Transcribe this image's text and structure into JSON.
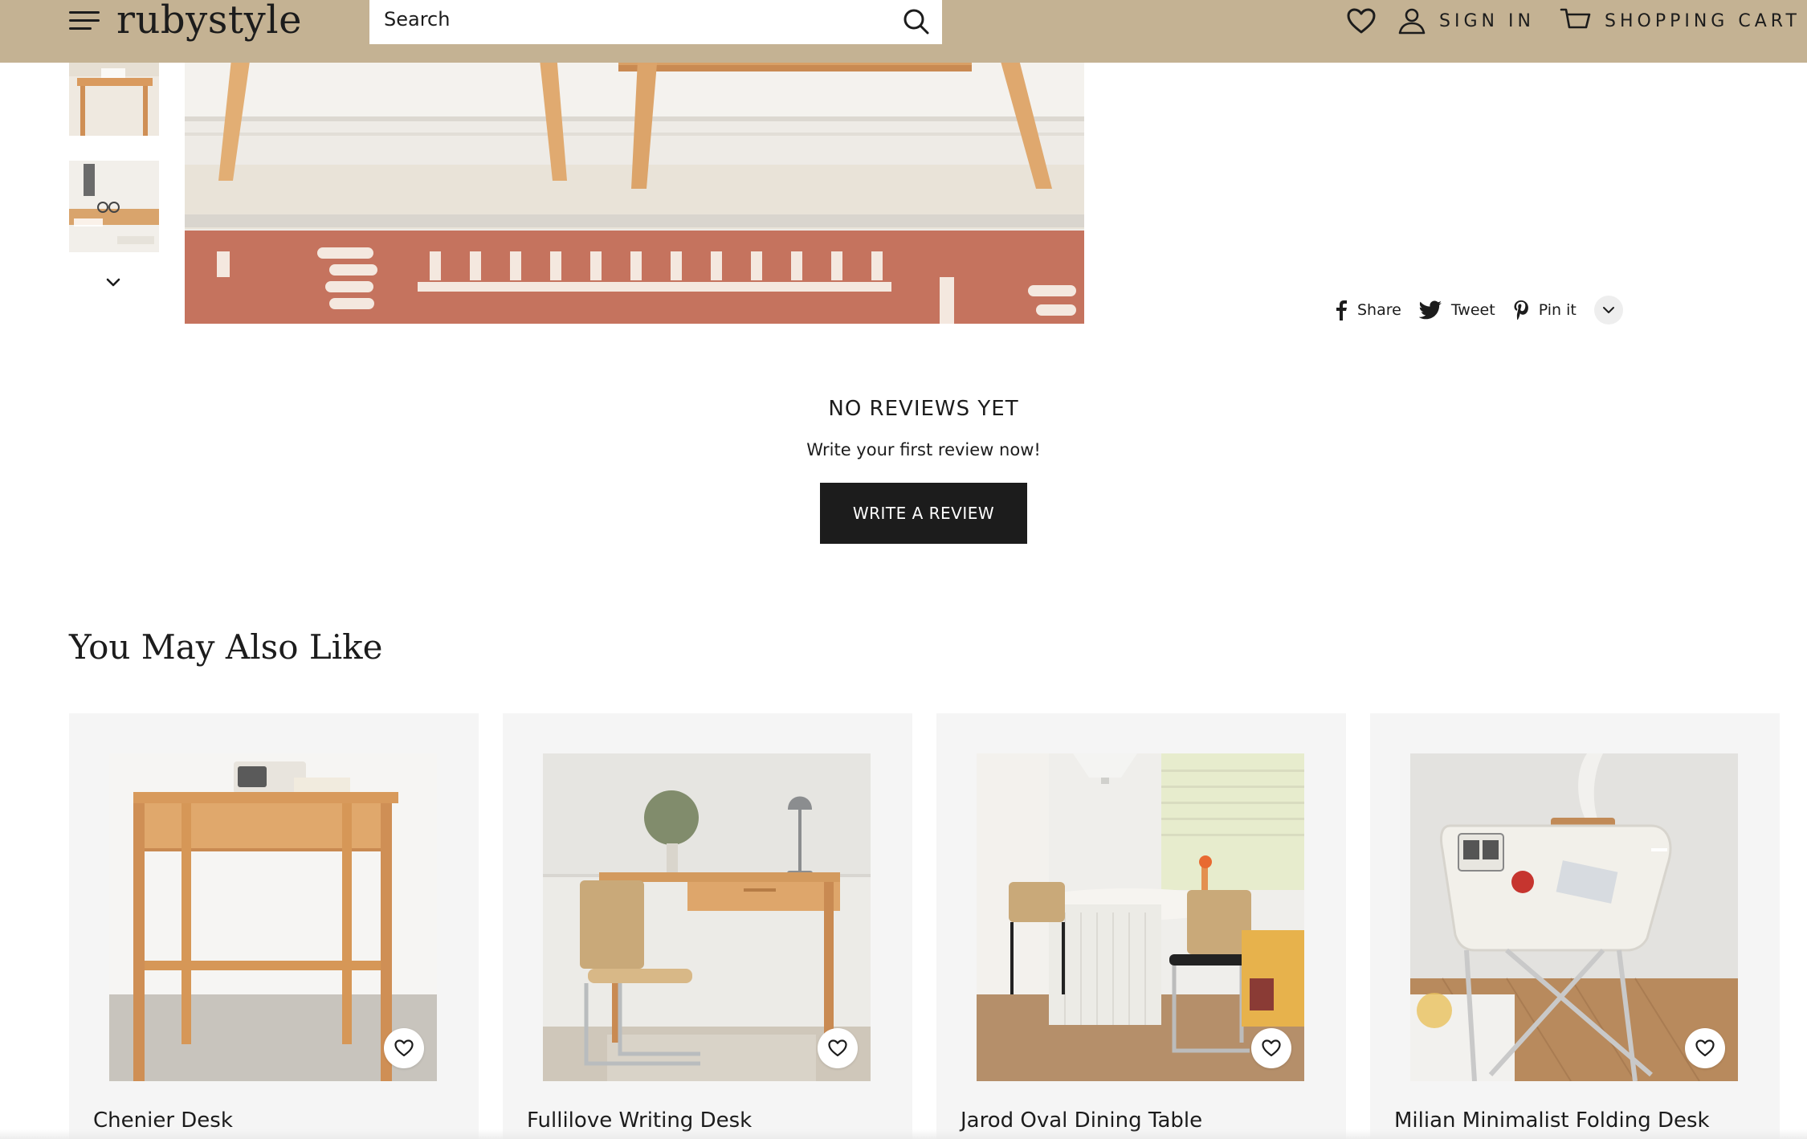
{
  "colors": {
    "header_bg": "#c4b293",
    "button_bg": "#1c1c1c",
    "card_bg": "#f5f5f5",
    "text": "#1c1c1c"
  },
  "header": {
    "menu_icon": "hamburger-menu-icon",
    "logo": "rubystyle",
    "search": {
      "placeholder": "Search",
      "value": "",
      "icon": "search-icon"
    },
    "wishlist_icon": "heart-icon",
    "sign_in": {
      "label": "SIGN IN",
      "icon": "user-icon"
    },
    "cart": {
      "label": "SHOPPING CART",
      "icon": "cart-icon"
    }
  },
  "gallery": {
    "thumbnail_count_visible": 2,
    "scroll_icon": "chevron-down-icon"
  },
  "share": {
    "items": [
      {
        "label": "Share",
        "icon": "facebook-icon"
      },
      {
        "label": "Tweet",
        "icon": "twitter-icon"
      },
      {
        "label": "Pin it",
        "icon": "pinterest-icon"
      }
    ],
    "more_icon": "chevron-down-icon"
  },
  "reviews": {
    "title": "NO REVIEWS YET",
    "subtitle": "Write your first review now!",
    "button_label": "WRITE A REVIEW"
  },
  "recommendations": {
    "title": "You May Also Like",
    "products": [
      {
        "name": "Chenier Desk",
        "wishlist_icon": "heart-icon"
      },
      {
        "name": "Fullilove Writing Desk",
        "wishlist_icon": "heart-icon"
      },
      {
        "name": "Jarod Oval Dining Table",
        "wishlist_icon": "heart-icon"
      },
      {
        "name": "Milian Minimalist Folding Desk",
        "wishlist_icon": "heart-icon"
      }
    ]
  }
}
